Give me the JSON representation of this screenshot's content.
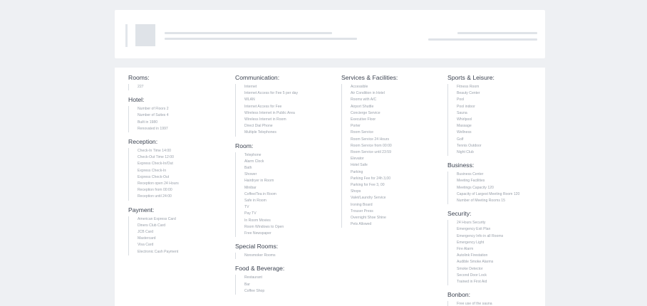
{
  "columns": [
    {
      "sections": [
        {
          "title": "Rooms:",
          "items": [
            "227"
          ]
        },
        {
          "title": "Hotel:",
          "items": [
            "Number of Floors 2",
            "Number of Suites 4",
            "Built in 1980",
            "Renovated in 1997"
          ]
        },
        {
          "title": "Reception:",
          "items": [
            "Check-In Time 14:00",
            "Check-Out Time 12:00",
            "Express Check-In/Out",
            "Express Check-In",
            "Express Check-Out",
            "Reception open 24 Hours",
            "Reception from 00:00",
            "Reception until 24:00"
          ]
        },
        {
          "title": "Payment:",
          "items": [
            "American Express Card",
            "Diners Club Card",
            "JCB Card",
            "Mastercard",
            "Visa Card",
            "Electronic Cash Payment"
          ]
        }
      ]
    },
    {
      "sections": [
        {
          "title": "Communication:",
          "items": [
            "Internet",
            "Internet Access for Fee 5 per day",
            "WLAN",
            "Internet Access for Fee",
            "Wireless Internet in Public Area",
            "Wireless Internet in Room",
            "Direct Dial Phone",
            "Multiple Telephones"
          ]
        },
        {
          "title": "Room:",
          "items": [
            "Telephone",
            "Alarm Clock",
            "Bath",
            "Shower",
            "Hairdryer in Room",
            "Minibar",
            "Coffee/Tea in Room",
            "Safe in Room",
            "TV",
            "Pay TV",
            "In Room Movies",
            "Room Windows to Open",
            "Free Newspaper"
          ]
        },
        {
          "title": "Special Rooms:",
          "items": [
            "Nonsmoker Rooms"
          ]
        },
        {
          "title": "Food & Beverage:",
          "items": [
            "Restaurant",
            "Bar",
            "Coffee Shop"
          ]
        }
      ]
    },
    {
      "sections": [
        {
          "title": "Services & Facilities:",
          "items": [
            "Accessible",
            "Air Condition in Hotel",
            "Rooms with A/C",
            "Airport Shuttle",
            "Concierge Service",
            "Executive Floor",
            "Porter",
            "Room Service",
            "Room Service 24 Hours",
            "Room Service from 00:00",
            "Room Service until 23:59",
            "Elevator",
            "Hotel Safe",
            "Parking",
            "Parking Fee for 24h 3,00",
            "Parking for Fee 3, 00",
            "Shops",
            "Valet/Laundry Service",
            "Ironing Board",
            "Trouser Press",
            "Overnight Shoe Shine",
            "Pets Allowed"
          ]
        }
      ]
    },
    {
      "sections": [
        {
          "title": "Sports & Leisure:",
          "items": [
            "Fitness Room",
            "Beauty Center",
            "Pool",
            "Pool indoor",
            "Sauna",
            "Whirlpool",
            "Massage",
            "Wellness",
            "Golf",
            "Tennis Outdoor",
            "Night Club"
          ]
        },
        {
          "title": "Business:",
          "items": [
            "Business Center",
            "Meeting Facilities",
            "Meetings Capacity 120",
            "Capacity of Largest Meeting Room 120",
            "Number of Meeting Rooms 15"
          ]
        },
        {
          "title": "Security:",
          "items": [
            "24 Hours Security",
            "Emergency Exit Plan",
            "Emergency Info in all Rooms",
            "Emergency Light",
            "Fire Alarm",
            "Autolink Firestation",
            "Audible Smoke Alarms",
            "Smoke Detector",
            "Second Door Lock",
            "Trained in First Aid"
          ]
        },
        {
          "title": "Bonbon:",
          "items": [
            "Free use of the sauna"
          ]
        }
      ]
    }
  ],
  "colors": {
    "background": "#eef0f3",
    "card": "#ffffff",
    "skeleton": "#dfe3e8",
    "heading": "#3b4250",
    "item": "#9aa1ab"
  }
}
